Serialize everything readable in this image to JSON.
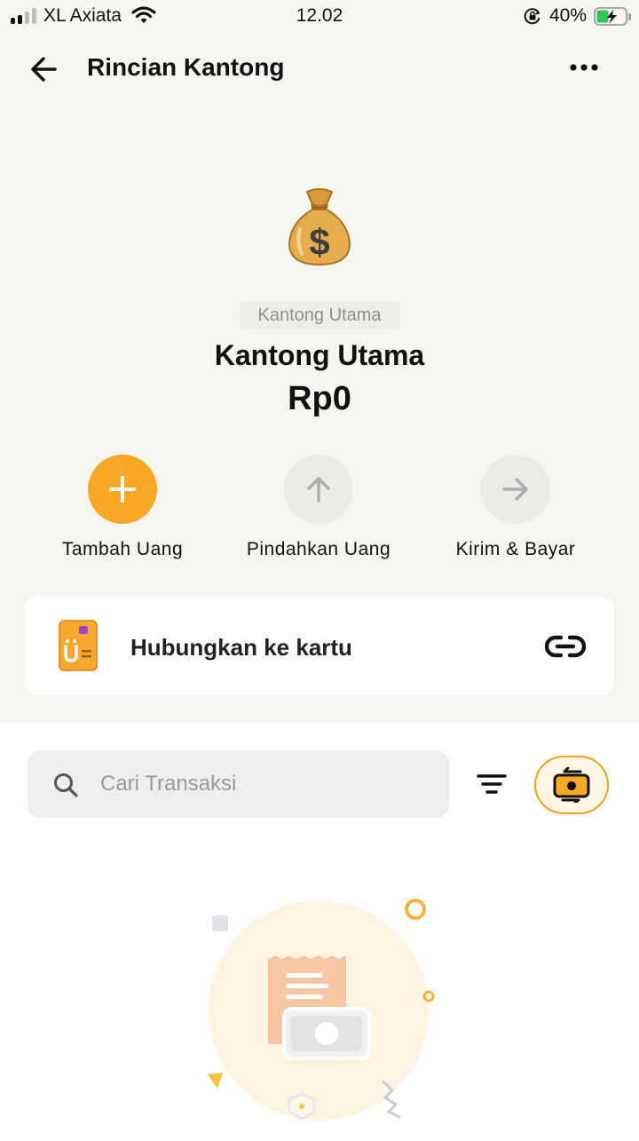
{
  "status_bar": {
    "carrier": "XL Axiata",
    "time": "12.02",
    "battery": "40%"
  },
  "header": {
    "title": "Rincian Kantong"
  },
  "pocket": {
    "tag": "Kantong Utama",
    "name": "Kantong Utama",
    "balance": "Rp0",
    "icon": "money-bag-icon"
  },
  "actions": [
    {
      "label": "Tambah Uang",
      "icon": "plus-icon",
      "color": "#f9a825"
    },
    {
      "label": "Pindahkan Uang",
      "icon": "arrow-up-icon",
      "color": "#ebebe7"
    },
    {
      "label": "Kirim & Bayar",
      "icon": "arrow-right-icon",
      "color": "#ebebe7"
    }
  ],
  "card_link": {
    "label": "Hubungkan ke kartu"
  },
  "search": {
    "placeholder": "Cari Transaksi"
  },
  "colors": {
    "accent": "#f9a825",
    "background_top": "#f6f5ef"
  }
}
